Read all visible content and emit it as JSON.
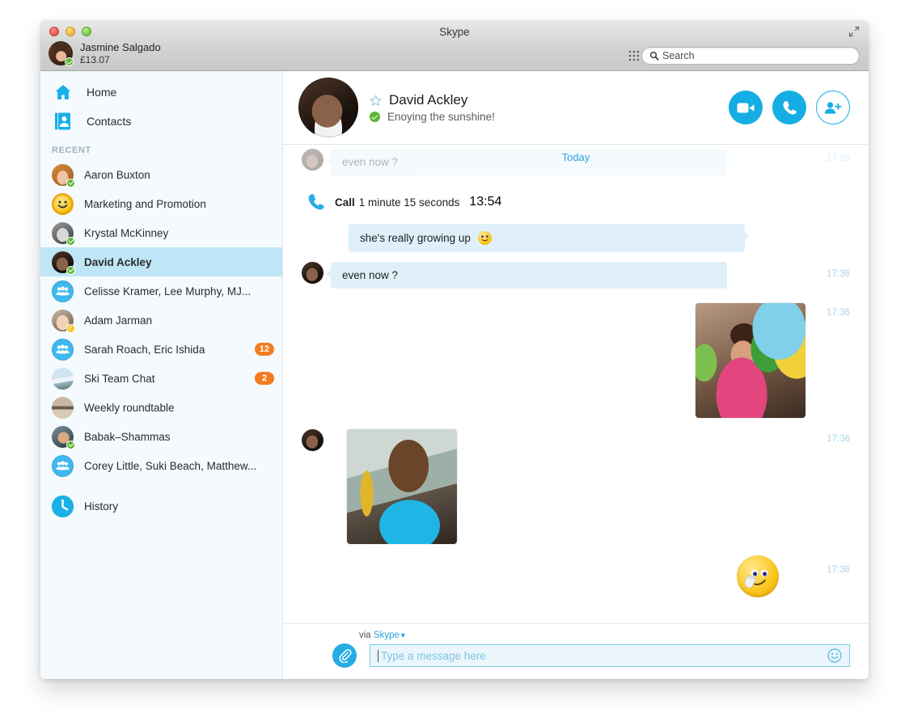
{
  "window": {
    "title": "Skype",
    "controls": [
      "close",
      "minimize",
      "zoom"
    ],
    "maximize_icon": "expand-icon"
  },
  "account": {
    "name": "Jasmine Salgado",
    "credit": "£13.07",
    "presence": "online",
    "avatar_icon": "user-avatar"
  },
  "search": {
    "placeholder": "Search",
    "value": "Search",
    "icon": "search-icon"
  },
  "dialpad": {
    "icon": "grid-icon"
  },
  "sidebar": {
    "nav": [
      {
        "label": "Home",
        "icon": "home-icon"
      },
      {
        "label": "Contacts",
        "icon": "contacts-icon"
      }
    ],
    "section_label": "RECENT",
    "items": [
      {
        "name": "Aaron Buxton",
        "avatar": "photo-avatar",
        "presence": "online",
        "badge": ""
      },
      {
        "name": "Marketing and Promotion",
        "avatar": "emoji-avatar",
        "presence": "",
        "badge": ""
      },
      {
        "name": "Krystal McKinney",
        "avatar": "photo-avatar",
        "presence": "online",
        "badge": ""
      },
      {
        "name": "David Ackley",
        "avatar": "photo-avatar",
        "presence": "online",
        "badge": "",
        "selected": true
      },
      {
        "name": "Celisse Kramer, Lee Murphy, MJ...",
        "avatar": "group-avatar",
        "presence": "",
        "badge": ""
      },
      {
        "name": "Adam Jarman",
        "avatar": "photo-avatar",
        "presence": "away",
        "badge": ""
      },
      {
        "name": "Sarah Roach, Eric Ishida",
        "avatar": "group-avatar",
        "presence": "",
        "badge": "12"
      },
      {
        "name": "Ski Team Chat",
        "avatar": "photo-avatar",
        "presence": "",
        "badge": "2"
      },
      {
        "name": "Weekly roundtable",
        "avatar": "photo-avatar",
        "presence": "",
        "badge": ""
      },
      {
        "name": "Babak–Shammas",
        "avatar": "photo-avatar",
        "presence": "online",
        "badge": ""
      },
      {
        "name": "Corey Little, Suki Beach, Matthew...",
        "avatar": "group-avatar",
        "presence": "",
        "badge": ""
      }
    ],
    "footer": {
      "label": "History",
      "icon": "clock-icon"
    }
  },
  "chat_header": {
    "name": "David Ackley",
    "mood": "Enoying the sunshine!",
    "presence": "online",
    "favourite_icon": "star-icon",
    "actions": [
      {
        "name": "video-call",
        "icon": "video-icon"
      },
      {
        "name": "voice-call",
        "icon": "phone-icon"
      },
      {
        "name": "add-people",
        "icon": "add-person-icon"
      }
    ]
  },
  "conversation": {
    "day_divider": "Today",
    "ghost_message": {
      "text": "even now ?",
      "time": "17:36"
    },
    "messages": [
      {
        "kind": "call",
        "label": "Call",
        "duration": "1 minute 15 seconds",
        "time": "13:54",
        "icon": "phone-icon"
      },
      {
        "kind": "text",
        "side": "right",
        "text": "she's really growing up",
        "emoticon": "smile-emoticon",
        "time": ""
      },
      {
        "kind": "text",
        "side": "left",
        "text": "even now ?",
        "time": "17:36"
      },
      {
        "kind": "photo",
        "side": "right",
        "alt": "girl-with-balloons-photo",
        "time": "17:36"
      },
      {
        "kind": "photo",
        "side": "left",
        "alt": "boy-with-trophy-photo",
        "time": "17:36"
      },
      {
        "kind": "emoticon",
        "side": "right",
        "alt": "giggle-emoticon",
        "time": "17:36"
      }
    ]
  },
  "composer": {
    "via_prefix": "via",
    "via_service": "Skype",
    "caret": "▼",
    "placeholder": "Type a message here",
    "value": "",
    "attach_icon": "paperclip-icon",
    "emoji_icon": "smiley-icon"
  },
  "colors": {
    "accent": "#15aee4",
    "link": "#2aa3e0",
    "bubble": "#dff0fa",
    "selected_row": "#bfe6f7",
    "badge": "#f47b20",
    "presence_online": "#5cb531",
    "presence_away": "#f5c518",
    "sidebar_bg": "#f4fafd",
    "timestamp": "#a9d4ea"
  }
}
